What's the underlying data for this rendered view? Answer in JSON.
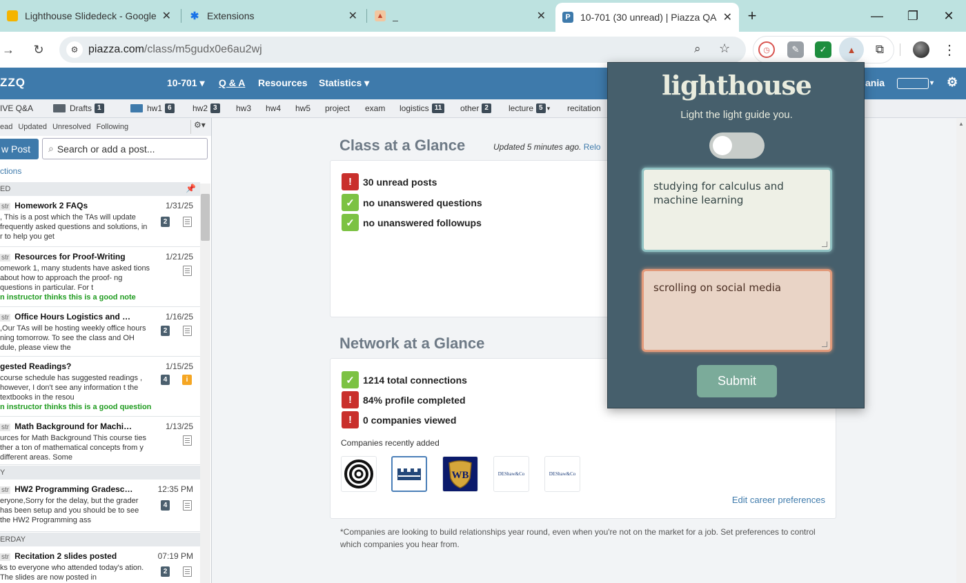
{
  "browser": {
    "tabs": [
      {
        "title": "Lighthouse Slidedeck - Google",
        "favicon_color": "#f4b400"
      },
      {
        "title": "Extensions",
        "favicon_color": "#1a73e8"
      },
      {
        "title": "_",
        "favicon_color": "#d97b52"
      },
      {
        "title": "10-701 (30 unread) | Piazza QA",
        "favicon_color": "#3e7aab",
        "active": true
      }
    ],
    "new_tab": "+",
    "close_glyph": "✕",
    "window": {
      "minimize": "—",
      "restore": "❐",
      "close": "✕"
    },
    "url_domain": "piazza.com",
    "url_path": "/class/m5gudx0e6au2wj"
  },
  "piazza": {
    "brand": "ZZQ",
    "course": "10-701",
    "nav": [
      "Q & A",
      "Resources",
      "Statistics"
    ],
    "user": "ania",
    "folders": [
      {
        "label": "IVE Q&A"
      },
      {
        "label": "Drafts",
        "count": "1"
      },
      {
        "label": "hw1",
        "count": "6"
      },
      {
        "label": "hw2",
        "count": "3"
      },
      {
        "label": "hw3"
      },
      {
        "label": "hw4"
      },
      {
        "label": "hw5"
      },
      {
        "label": "project"
      },
      {
        "label": "exam"
      },
      {
        "label": "logistics",
        "count": "11"
      },
      {
        "label": "other",
        "count": "2"
      },
      {
        "label": "lecture",
        "count": "5"
      },
      {
        "label": "recitation"
      }
    ],
    "filters": [
      "ead",
      "Updated",
      "Unresolved",
      "Following"
    ],
    "new_post": "w Post",
    "search_placeholder": "Search or add a post...",
    "actions_link": "ctions",
    "sections": {
      "pinned": "ED",
      "today": "Y",
      "yesterday": "ERDAY"
    },
    "posts": [
      {
        "tag": "str",
        "title": "Homework 2 FAQs",
        "date": "1/31/25",
        "body": ", This is a post which the TAs will update frequently asked questions and solutions, in r to help you get",
        "count": "2"
      },
      {
        "tag": "str",
        "title": "Resources for Proof-Writing",
        "date": "1/21/25",
        "body": "omework 1, many students have asked tions about how to approach the proof- ng questions in particular. For t",
        "good": "n instructor thinks this is a good note"
      },
      {
        "tag": "str",
        "title": "Office Hours Logistics and …",
        "date": "1/16/25",
        "body": ",Our TAs will be hosting weekly office hours ning tomorrow. To see the class and OH dule, please view the",
        "count": "2"
      },
      {
        "tag": "",
        "title": "gested Readings?",
        "date": "1/15/25",
        "body": "course schedule has suggested readings , however, I don't see any information t the textbooks in the resou",
        "count": "4",
        "good": "n instructor thinks this is a good question"
      },
      {
        "tag": "str",
        "title": "Math Background for Machi…",
        "date": "1/13/25",
        "body": "urces for Math Background This course ties ther a ton of mathematical concepts from y different areas. Some"
      },
      {
        "tag": "str",
        "title": "HW2 Programming Gradesc…",
        "date": "12:35 PM",
        "body": "eryone,Sorry for the delay, but the grader has been setup and you should be to see the HW2 Programming ass",
        "count": "4"
      },
      {
        "tag": "str",
        "title": "Recitation 2 slides posted",
        "date": "07:19 PM",
        "body": "ks to everyone who attended today's ation. The slides are now posted in",
        "count": "2"
      }
    ]
  },
  "main": {
    "class_title": "Class at a Glance",
    "updated": "Updated 5 minutes ago.",
    "reload": "Relo",
    "class_stats": [
      {
        "text": "30 unread posts",
        "status": "bad"
      },
      {
        "text": "no unanswered questions",
        "status": "good"
      },
      {
        "text": "no unanswered followups",
        "status": "good"
      }
    ],
    "network_title": "Network at a Glance",
    "network_stats": [
      {
        "text": "1214 total connections",
        "status": "good"
      },
      {
        "text": "84% profile completed",
        "status": "bad"
      },
      {
        "text": "0 companies viewed",
        "status": "bad"
      }
    ],
    "companies_label": "Companies recently added",
    "company_logos": [
      "ring-logo",
      "castle-logo",
      "wb-logo",
      "deshaw-logo",
      "deshaw-logo"
    ],
    "deshaw_text": "DEShaw&Co",
    "wb_text": "WB",
    "edit_career": "Edit career preferences",
    "footnote": "*Companies are looking to build relationships year round, even when you're not on the market for a job. Set preferences to control which companies you hear from."
  },
  "lighthouse": {
    "title": "lighthouse",
    "tagline": "Light the light guide you.",
    "toggle_on": false,
    "goal_text": "studying for calculus and machine learning",
    "distraction_text": "scrolling on social media",
    "submit": "Submit"
  }
}
